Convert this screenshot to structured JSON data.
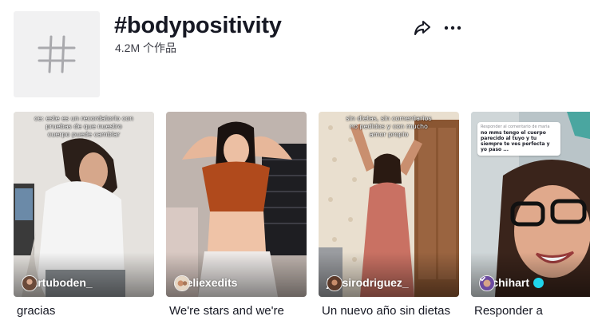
{
  "hashtag": {
    "title": "#bodypositivity",
    "count": "4.2M 个作品",
    "icons": {
      "thumb": "hashtag-icon",
      "share": "share-arrow-icon",
      "more": "more-dots-icon"
    }
  },
  "videos": [
    {
      "username": "martuboden_",
      "caption": "gracias",
      "caption_line2": "",
      "overlay_text": [
        "ce: este es un recordatorio con",
        "pruebas de que nuestro",
        "cuerpo puede cambiar"
      ],
      "verified": false
    },
    {
      "username": "aveliexedits",
      "caption": "We're stars and we're",
      "caption_line2": "",
      "overlay_text": [],
      "verified": false
    },
    {
      "username": "jessirodriguez_",
      "caption": "Un nuevo año sin dietas",
      "caption_line2": "",
      "overlay_text": [
        "sin dietas, sin comentarios",
        "no pedidos y con mucho",
        "amor propio"
      ],
      "verified": false
    },
    {
      "username": "michihart",
      "caption": "Responder a",
      "caption_line2": "",
      "overlay_text": [],
      "reply_head": "Responder al comentario de maria",
      "reply_text": "no mms tengo el cuerpo parecido al tuyo y tu siempre te ves perfecta y yo paso ...",
      "verified": true
    }
  ],
  "colors": {
    "text": "#161823",
    "subtext": "#3c3d46",
    "verified": "#20d5ec"
  }
}
